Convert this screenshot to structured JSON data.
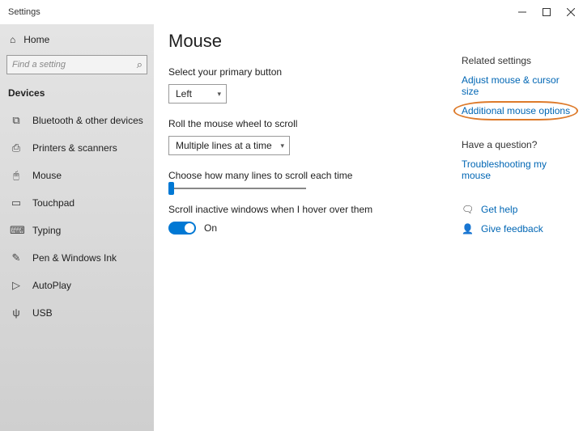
{
  "window": {
    "title": "Settings"
  },
  "sidebar": {
    "home_label": "Home",
    "search_placeholder": "Find a setting",
    "section_title": "Devices",
    "items": [
      {
        "icon": "bluetooth-icon",
        "glyph": "⧉",
        "label": "Bluetooth & other devices"
      },
      {
        "icon": "printer-icon",
        "glyph": "⎙",
        "label": "Printers & scanners"
      },
      {
        "icon": "mouse-icon",
        "glyph": "🖰",
        "label": "Mouse"
      },
      {
        "icon": "touchpad-icon",
        "glyph": "▭",
        "label": "Touchpad"
      },
      {
        "icon": "typing-icon",
        "glyph": "⌨",
        "label": "Typing"
      },
      {
        "icon": "pen-icon",
        "glyph": "✎",
        "label": "Pen & Windows Ink"
      },
      {
        "icon": "autoplay-icon",
        "glyph": "▷",
        "label": "AutoPlay"
      },
      {
        "icon": "usb-icon",
        "glyph": "ψ",
        "label": "USB"
      }
    ]
  },
  "main": {
    "title": "Mouse",
    "primary_button": {
      "label": "Select your primary button",
      "value": "Left"
    },
    "wheel_scroll": {
      "label": "Roll the mouse wheel to scroll",
      "value": "Multiple lines at a time"
    },
    "lines_slider": {
      "label": "Choose how many lines to scroll each time"
    },
    "inactive_scroll": {
      "label": "Scroll inactive windows when I hover over them",
      "state_text": "On"
    }
  },
  "right": {
    "related_head": "Related settings",
    "related_links": [
      "Adjust mouse & cursor size",
      "Additional mouse options"
    ],
    "question_head": "Have a question?",
    "question_links": [
      "Troubleshooting my mouse"
    ],
    "help_label": "Get help",
    "feedback_label": "Give feedback"
  }
}
